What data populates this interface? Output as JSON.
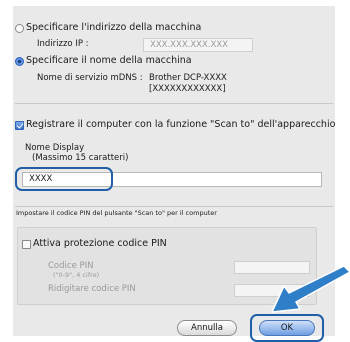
{
  "machine": {
    "address_option": "Specificare l'indirizzo della macchina",
    "ip_label": "Indirizzo IP :",
    "ip_placeholder": "XXX.XXX.XXX.XXX",
    "name_option": "Specificare il nome della macchina",
    "mdns_label": "Nome di servizio mDNS :",
    "mdns_value_line1": "Brother DCP-XXXX",
    "mdns_value_line2": "[XXXXXXXXXXXX]"
  },
  "register": {
    "checkbox_label": "Registrare il computer con la funzione \"Scan to\" dell'apparecchio",
    "display_label": "Nome Display",
    "display_hint": "(Massimo 15 caratteri)",
    "display_value": "XXXX"
  },
  "pin": {
    "section_title": "Impostare il codice PIN del pulsante \"Scan to\" per il computer",
    "protect_label": "Attiva protezione codice PIN",
    "code_label": "Codice PIN",
    "code_hint": "(\"0-9\", 4 cifre)",
    "confirm_label": "Ridigitare codice PIN"
  },
  "buttons": {
    "cancel": "Annulla",
    "ok": "OK"
  },
  "colors": {
    "highlight": "#1f5fa8",
    "arrow": "#2f7fc8"
  }
}
